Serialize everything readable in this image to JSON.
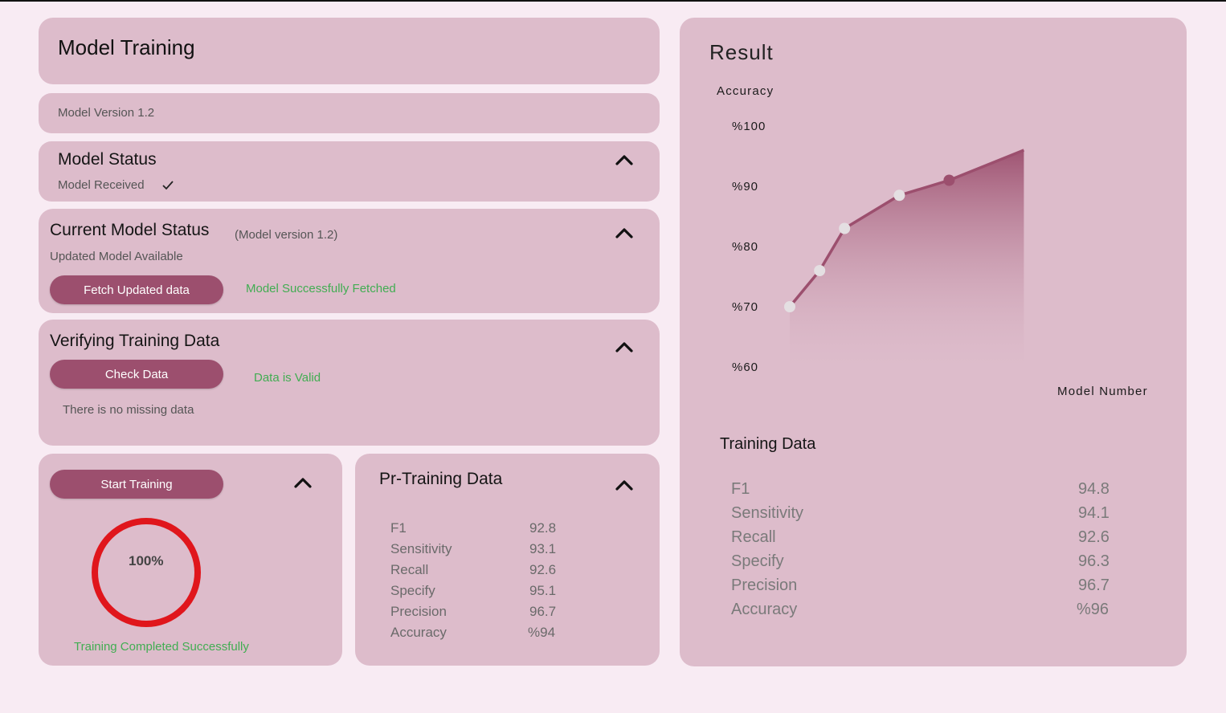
{
  "header": {
    "title": "Model Training"
  },
  "version_bar": {
    "label": "Model Version 1.2"
  },
  "model_status": {
    "title": "Model Status",
    "status": "Model Received",
    "check_icon": "check-icon"
  },
  "current_status": {
    "title": "Current Model Status",
    "version_note": "(Model version 1.2)",
    "status": "Updated Model Available",
    "button_label": "Fetch Updated data",
    "result": "Model Successfully Fetched"
  },
  "verify": {
    "title": "Verifying Training Data",
    "button_label": "Check Data",
    "result": "Data is Valid",
    "note": "There is no missing data"
  },
  "training": {
    "button_label": "Start Training",
    "progress_text": "100%",
    "progress": 1.0,
    "message": "Training Completed Successfully",
    "ring_color": "#e0161c"
  },
  "pre_training": {
    "title": "Pr-Training Data",
    "rows": [
      {
        "label": "F1",
        "value": "92.8"
      },
      {
        "label": "Sensitivity",
        "value": "93.1"
      },
      {
        "label": "Recall",
        "value": "92.6"
      },
      {
        "label": "Specify",
        "value": "95.1"
      },
      {
        "label": "Precision",
        "value": "96.7"
      },
      {
        "label": "Accuracy",
        "value": "%94"
      }
    ]
  },
  "result": {
    "title": "Result",
    "training_title": "Training Data",
    "rows": [
      {
        "label": "F1",
        "value": "94.8"
      },
      {
        "label": "Sensitivity",
        "value": "94.1"
      },
      {
        "label": "Recall",
        "value": "92.6"
      },
      {
        "label": "Specify",
        "value": "96.3"
      },
      {
        "label": "Precision",
        "value": "96.7"
      },
      {
        "label": "Accuracy",
        "value": "%96"
      }
    ]
  },
  "chart_data": {
    "type": "area",
    "title": "",
    "ylabel": "Accuracy",
    "xlabel": "Model Number",
    "y_ticks": [
      "%100",
      "%90",
      "%80",
      "%70",
      "%60"
    ],
    "ylim": [
      60,
      100
    ],
    "xlim": [
      1,
      8.5
    ],
    "grid": false,
    "series": [
      {
        "x": [
          1,
          1.6,
          2.1,
          3.2,
          4.2,
          5.7
        ],
        "y": [
          70,
          76,
          83,
          88.5,
          91,
          96
        ],
        "markers": [
          1,
          1,
          1,
          1,
          1,
          0
        ],
        "highlight_index": 4
      }
    ],
    "colors": {
      "line": "#9c4f6e",
      "marker": "#e4dfe2",
      "highlight": "#9c4f6e"
    }
  },
  "colors": {
    "accent": "#9c4f6e",
    "success": "#41ad52",
    "card": "#ddbccb",
    "background": "#f8ebf3"
  }
}
